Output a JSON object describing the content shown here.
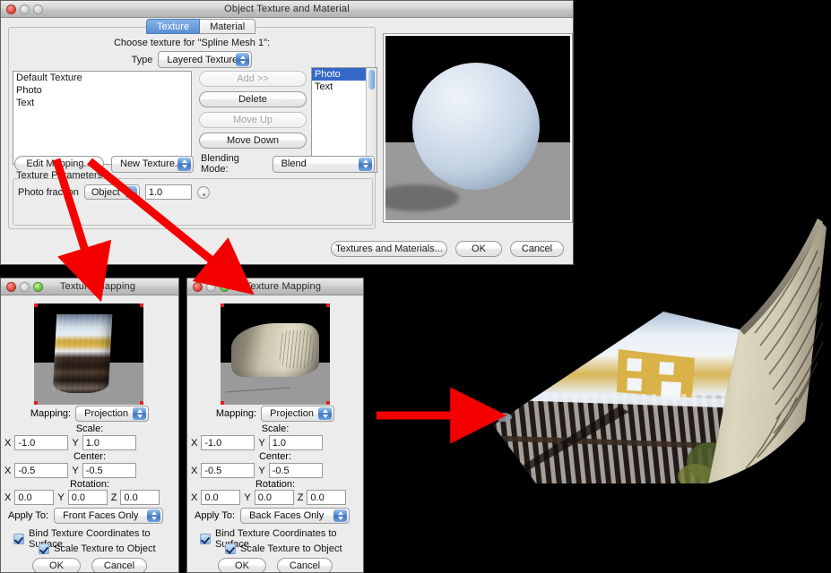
{
  "main_window": {
    "title": "Object Texture and Material",
    "traffic_lights": [
      "close-light",
      "minimize-light",
      "zoom-light"
    ],
    "tabs": [
      {
        "label": "Texture",
        "active": true
      },
      {
        "label": "Material",
        "active": false
      }
    ],
    "prompt": "Choose texture for \"Spline Mesh 1\":",
    "type_label": "Type",
    "type_value": "Layered Texture",
    "texture_list": [
      "Default Texture",
      "Photo",
      "Text"
    ],
    "mid_buttons": [
      {
        "label": "Add >>",
        "enabled": false
      },
      {
        "label": "Delete",
        "enabled": true
      },
      {
        "label": "Move Up",
        "enabled": false
      },
      {
        "label": "Move Down",
        "enabled": true
      }
    ],
    "layer_list": [
      {
        "label": "Photo",
        "selected": true
      },
      {
        "label": "Text",
        "selected": false
      }
    ],
    "edit_mapping_label": "Edit Mapping...",
    "new_texture_label": "New Texture...",
    "blending_mode_label": "Blending Mode:",
    "blending_mode_value": "Blend",
    "texture_parameters_label": "Texture Parameters",
    "parameter": {
      "name": "Photo fraction",
      "source": "Object",
      "value": "1.0"
    },
    "bottom_buttons": [
      {
        "label": "Textures and Materials..."
      },
      {
        "label": "OK"
      },
      {
        "label": "Cancel"
      }
    ]
  },
  "mapping_left": {
    "title": "Texture Mapping",
    "preview_name": "photo-mapping-preview",
    "mapping_label": "Mapping:",
    "mapping_value": "Projection",
    "scale_label": "Scale:",
    "scale": {
      "x_label": "X",
      "x": "-1.0",
      "y_label": "Y",
      "y": "1.0"
    },
    "center_label": "Center:",
    "center": {
      "x_label": "X",
      "x": "-0.5",
      "y_label": "Y",
      "y": "-0.5"
    },
    "rotation_label": "Rotation:",
    "rotation": {
      "x_label": "X",
      "x": "0.0",
      "y_label": "Y",
      "y": "0.0",
      "z_label": "Z",
      "z": "0.0"
    },
    "apply_to_label": "Apply To:",
    "apply_to_value": "Front Faces Only",
    "bind_label": "Bind Texture Coordinates to Surface",
    "bind_checked": true,
    "scale_to_object_label": "Scale Texture to Object",
    "scale_to_object_checked": true,
    "ok_label": "OK",
    "cancel_label": "Cancel"
  },
  "mapping_right": {
    "title": "Texture Mapping",
    "preview_name": "text-mapping-preview",
    "mapping_label": "Mapping:",
    "mapping_value": "Projection",
    "scale_label": "Scale:",
    "scale": {
      "x_label": "X",
      "x": "-1.0",
      "y_label": "Y",
      "y": "1.0"
    },
    "center_label": "Center:",
    "center": {
      "x_label": "X",
      "x": "-0.5",
      "y_label": "Y",
      "y": "-0.5"
    },
    "rotation_label": "Rotation:",
    "rotation": {
      "x_label": "X",
      "x": "0.0",
      "y_label": "Y",
      "y": "0.0",
      "z_label": "Z",
      "z": "0.0"
    },
    "apply_to_label": "Apply To:",
    "apply_to_value": "Back Faces Only",
    "bind_label": "Bind Texture Coordinates to Surface",
    "bind_checked": true,
    "scale_to_object_label": "Scale Texture to Object",
    "scale_to_object_checked": true,
    "ok_label": "OK",
    "cancel_label": "Cancel"
  },
  "annotations": {
    "arrow_color": "#f40000",
    "arrows": [
      {
        "name": "arrow-edit-mapping-to-left-dialog"
      },
      {
        "name": "arrow-edit-mapping-to-right-dialog"
      },
      {
        "name": "arrow-to-final-render"
      }
    ]
  },
  "final_render": {
    "name": "spline-mesh-final-render",
    "description": "Curved spline mesh, photo of snowy house and fence on front face, book page text on back face"
  },
  "colors": {
    "selection_blue": "#3569c8",
    "arrow_red": "#f40000",
    "window_gray": "#ececec"
  }
}
